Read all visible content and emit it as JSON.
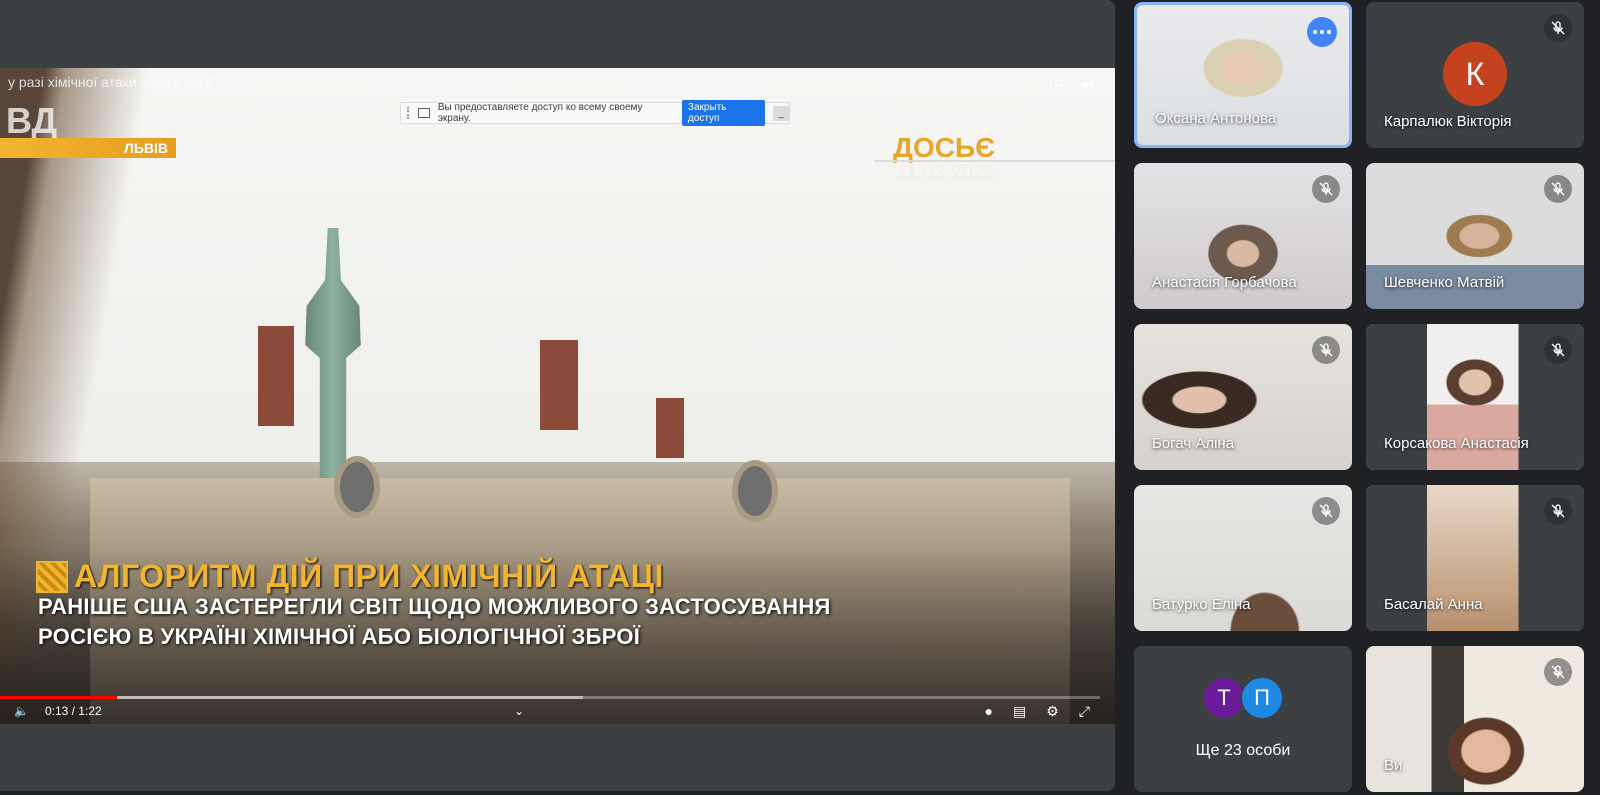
{
  "video": {
    "title": "у разі хімічної атаки з боку росії?",
    "brand_logo": "ВД",
    "brand_city": "ЛЬВІВ",
    "dossier_label": "ДОСЬЄ",
    "dossier_date": "11.03.2022",
    "headline": "АЛГОРИТМ ДІЙ ПРИ ХІМІЧНІЙ АТАЦІ",
    "subline_1": "РАНІШЕ США ЗАСТЕРЕГЛИ СВІТ ЩОДО МОЖЛИВОГО ЗАСТОСУВАННЯ",
    "subline_2": "РОСІЄЮ В УКРАЇНІ ХІМІЧНОЇ АБО БІОЛОГІЧНОЇ ЗБРОЇ",
    "time": "0:13 / 1:22",
    "progress": 0.106,
    "buffered": 0.53,
    "progress_color": "#ff0000"
  },
  "share_bar": {
    "message": "Вы предоставляете доступ ко всему своему экрану.",
    "stop_label": "Закрыть доступ",
    "hide_label": "_"
  },
  "participants": [
    {
      "name": "Оксана Антонова",
      "speaking": true
    },
    {
      "name": "Карпалюк Вікторія",
      "avatar_letter": "К",
      "avatar_color": "#c5421f"
    },
    {
      "name": "Анастасія Горбачова"
    },
    {
      "name": "Шевченко Матвій"
    },
    {
      "name": "Богач Аліна"
    },
    {
      "name": "Корсакова Анастасія"
    },
    {
      "name": "Батурко Еліна"
    },
    {
      "name": "Басалай Анна"
    },
    {
      "name": "Ви"
    }
  ],
  "overflow": {
    "label": "Ще 23 особи",
    "avatars": [
      {
        "letter": "Т",
        "color": "#6a1b9a"
      },
      {
        "letter": "П",
        "color": "#1e88e5"
      }
    ]
  },
  "colors": {
    "accent_blue": "#4285f4",
    "active_border": "#8ab4f8",
    "tile_bg": "#3c4043",
    "app_bg": "#202124"
  }
}
